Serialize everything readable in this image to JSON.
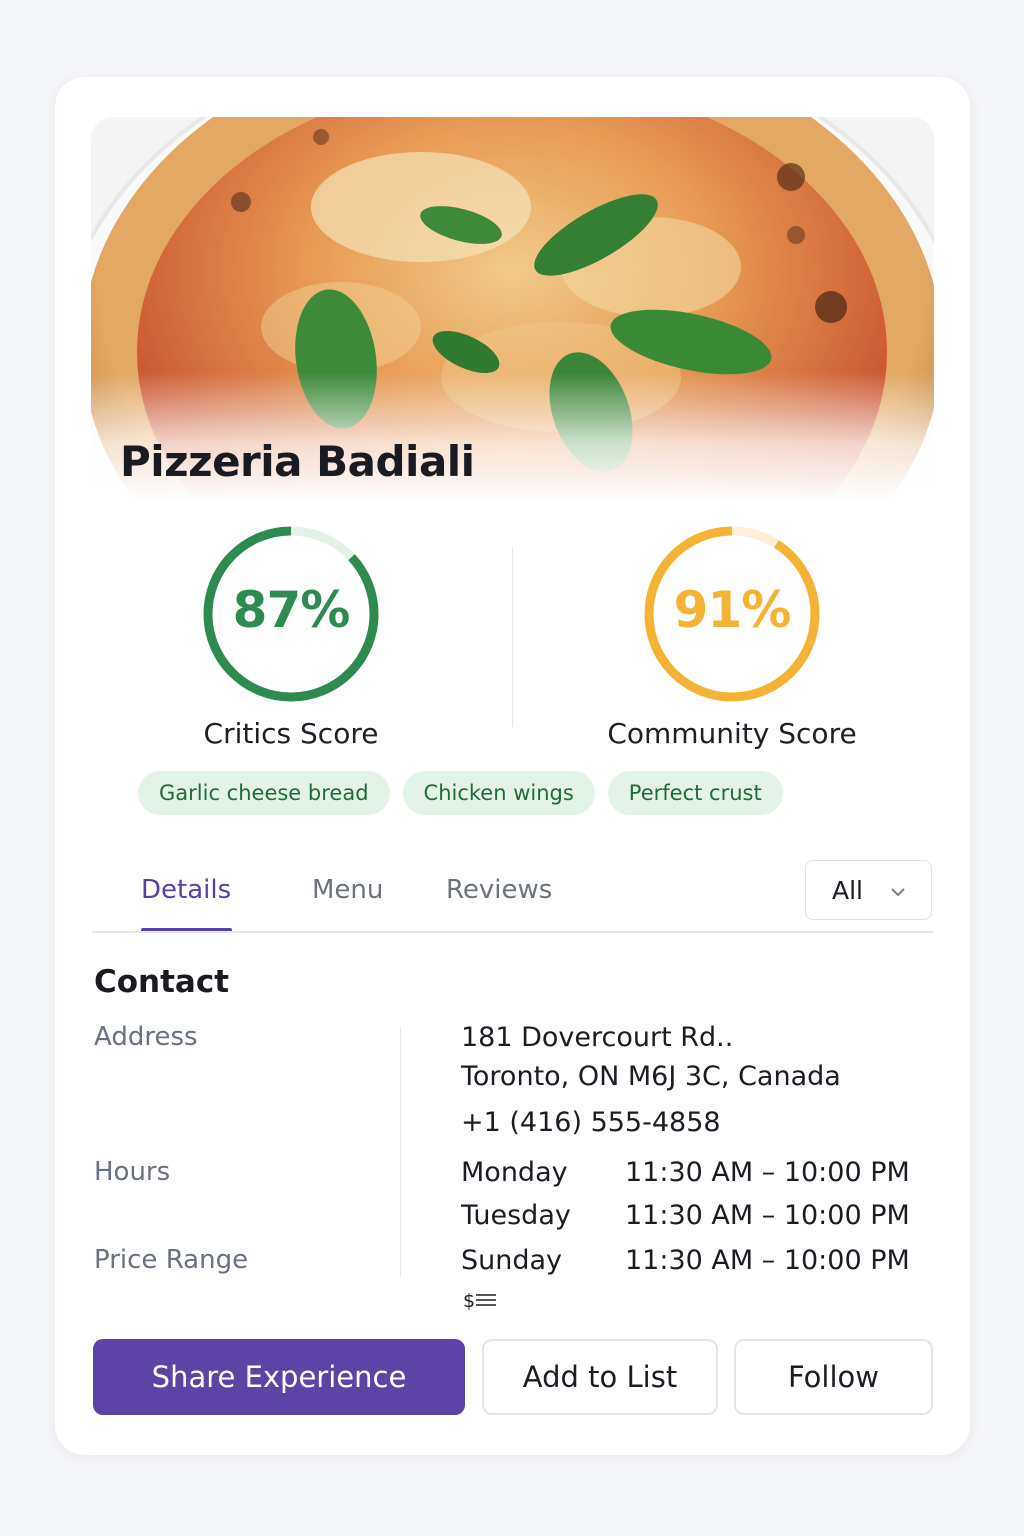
{
  "restaurant": {
    "name": "Pizzeria Badiali"
  },
  "scores": {
    "critics": {
      "value": "87%",
      "fraction": 0.87,
      "label": "Critics Score",
      "color": "#2e8b50",
      "track": "#e3f1e6"
    },
    "community": {
      "value": "91%",
      "fraction": 0.91,
      "label": "Community Score",
      "color": "#f5b335",
      "track": "#fcefd6"
    }
  },
  "chips": [
    "Garlic cheese bread",
    "Chicken wings",
    "Perfect crust"
  ],
  "tabs": {
    "details": "Details",
    "menu": "Menu",
    "reviews": "Reviews",
    "active": "Details"
  },
  "filter": {
    "selected": "All",
    "icon": "chevron-down-icon"
  },
  "contact": {
    "title": "Contact",
    "address_label": "Address",
    "address_line1": "181 Dovercourt Rd..",
    "address_line2": "Toronto, ON M6J 3C, Canada",
    "phone": "+1 (416) 555-4858",
    "hours_label": "Hours",
    "hours": [
      {
        "day": "Monday",
        "time": "11:30 AM – 10:00 PM"
      },
      {
        "day": "Tuesday",
        "time": "11:30 AM – 10:00 PM"
      },
      {
        "day": "Sunday",
        "time": "11:30 AM – 10:00 PM"
      }
    ],
    "price_label": "Price Range",
    "price_value": "$"
  },
  "actions": {
    "share": "Share Experience",
    "add": "Add to List",
    "follow": "Follow"
  },
  "colors": {
    "accent": "#5e43a6",
    "chip_bg": "#e4f3e8",
    "chip_text": "#1f6b3a"
  }
}
